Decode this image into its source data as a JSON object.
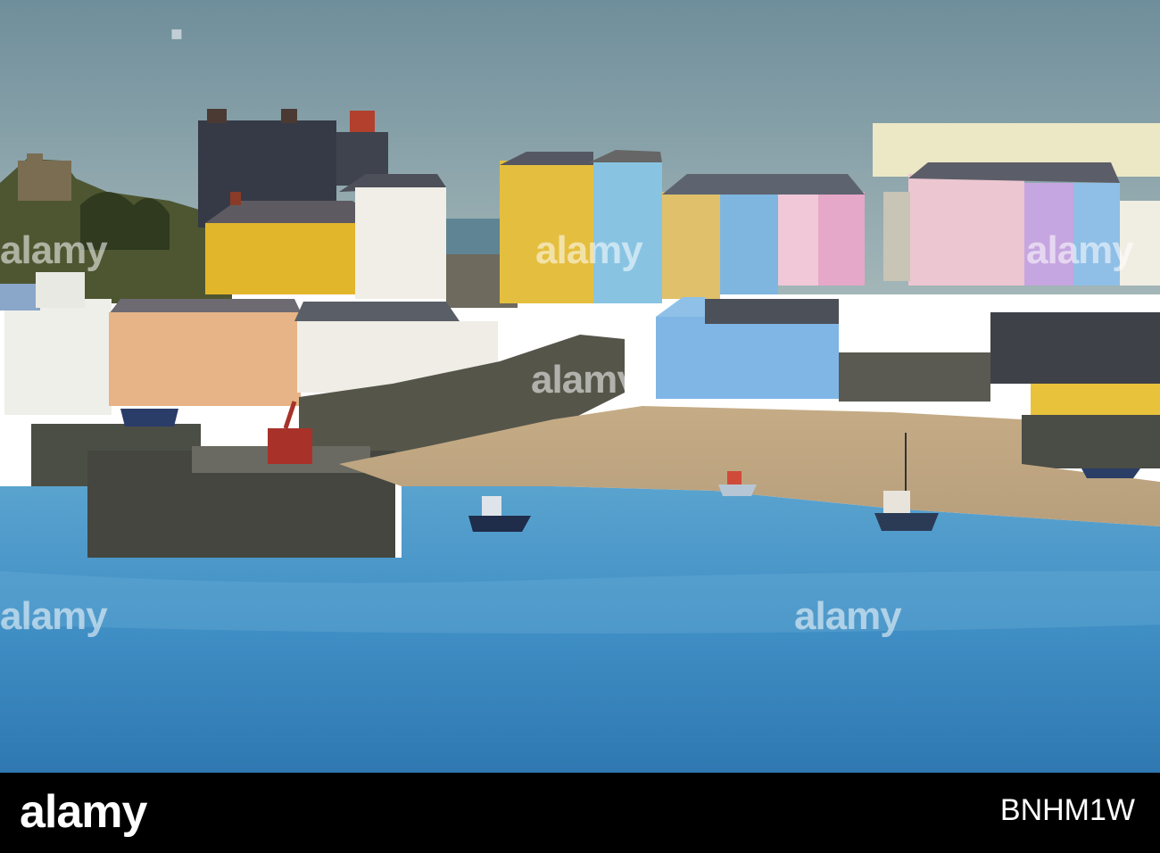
{
  "photo": {
    "watermark_text": "alamy",
    "colors": {
      "sky": "#7c9aa6",
      "water": "#3f8fc3",
      "sand": "#cbb48e",
      "wall": "#4f4f42"
    }
  },
  "footer": {
    "logo": "alamy",
    "image_id": "BNHM1W"
  }
}
